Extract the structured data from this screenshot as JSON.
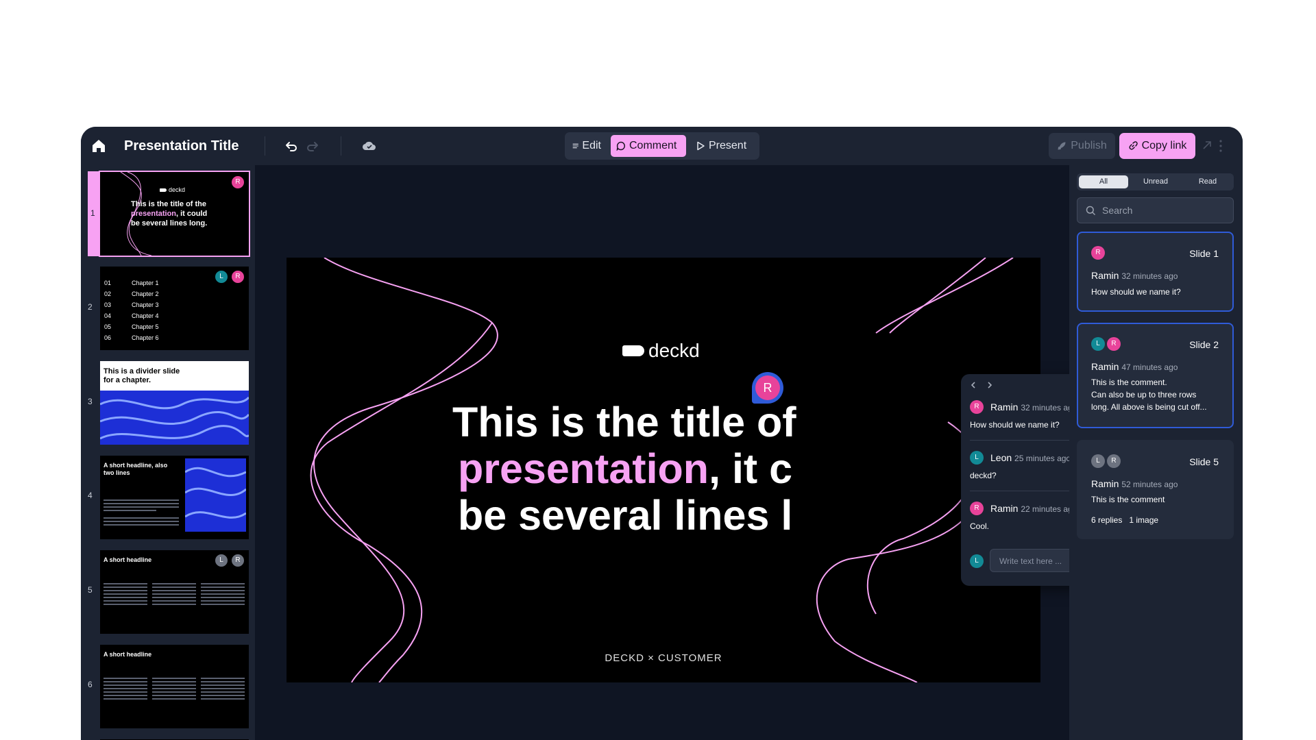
{
  "header": {
    "title": "Presentation Title",
    "modes": [
      {
        "label": "Edit",
        "active": false
      },
      {
        "label": "Comment",
        "active": true
      },
      {
        "label": "Present",
        "active": false
      }
    ],
    "publish_label": "Publish",
    "copy_link_label": "Copy link"
  },
  "thumbnails": [
    {
      "number": "1",
      "logo": "deckd",
      "title_a": "This is the title of the",
      "title_hl": "presentation",
      "title_b": ", it could",
      "title_c": "be several lines long.",
      "avatars": [
        "R"
      ]
    },
    {
      "number": "2",
      "rows": [
        [
          "01",
          "Chapter 1"
        ],
        [
          "02",
          "Chapter 2"
        ],
        [
          "03",
          "Chapter 3"
        ],
        [
          "04",
          "Chapter 4"
        ],
        [
          "05",
          "Chapter 5"
        ],
        [
          "06",
          "Chapter 6"
        ]
      ],
      "avatars": [
        "L",
        "R"
      ]
    },
    {
      "number": "3",
      "title_a": "This is a divider slide",
      "title_b": "for a chapter."
    },
    {
      "number": "4",
      "title_a": "A short headline, also",
      "title_b": "two lines"
    },
    {
      "number": "5",
      "title_a": "A short headline",
      "avatars": [
        "L",
        "R"
      ]
    },
    {
      "number": "6",
      "title_a": "A short headline"
    }
  ],
  "slide": {
    "logo": "deckd",
    "title_line1": "This is the title of",
    "title_hl": "presentation",
    "title_line2_rest": ", it c",
    "title_line3": "be several lines l",
    "footer": "DECKD × CUSTOMER",
    "pin_initial": "R"
  },
  "thread": {
    "comments": [
      {
        "initial": "R",
        "name": "Ramin",
        "time": "32 minutes ago",
        "text": "How should we name it?"
      },
      {
        "initial": "L",
        "name": "Leon",
        "time": "25 minutes ago",
        "text": "deckd?"
      },
      {
        "initial": "R",
        "name": "Ramin",
        "time": "22 minutes ago",
        "text": "Cool."
      }
    ],
    "reply_initial": "L",
    "reply_placeholder": "Write text here ..."
  },
  "panel": {
    "filters": [
      {
        "label": "All",
        "active": true
      },
      {
        "label": "Unread",
        "active": false
      },
      {
        "label": "Read",
        "active": false
      }
    ],
    "search_placeholder": "Search",
    "cards": [
      {
        "slide": "Slide 1",
        "name": "Ramin",
        "time": "32 minutes ago",
        "text": "How should we name it?",
        "avatars": [
          "R"
        ]
      },
      {
        "slide": "Slide 2",
        "name": "Ramin",
        "time": "47 minutes ago",
        "text_lines": [
          "This is the comment.",
          "Can also be up to three rows",
          "long. All above is being cut off..."
        ],
        "avatars": [
          "L",
          "R"
        ]
      },
      {
        "slide": "Slide 5",
        "name": "Ramin",
        "time": "52 minutes ago",
        "text": "This is the comment",
        "replies": "6 replies",
        "images": "1 image",
        "avatars": [
          "L",
          "R"
        ]
      }
    ]
  },
  "colors": {
    "accent_pink": "#f7a2f3",
    "accent_blue": "#2f5bd8",
    "avatar_pink": "#e8439a",
    "avatar_teal": "#128a96"
  }
}
